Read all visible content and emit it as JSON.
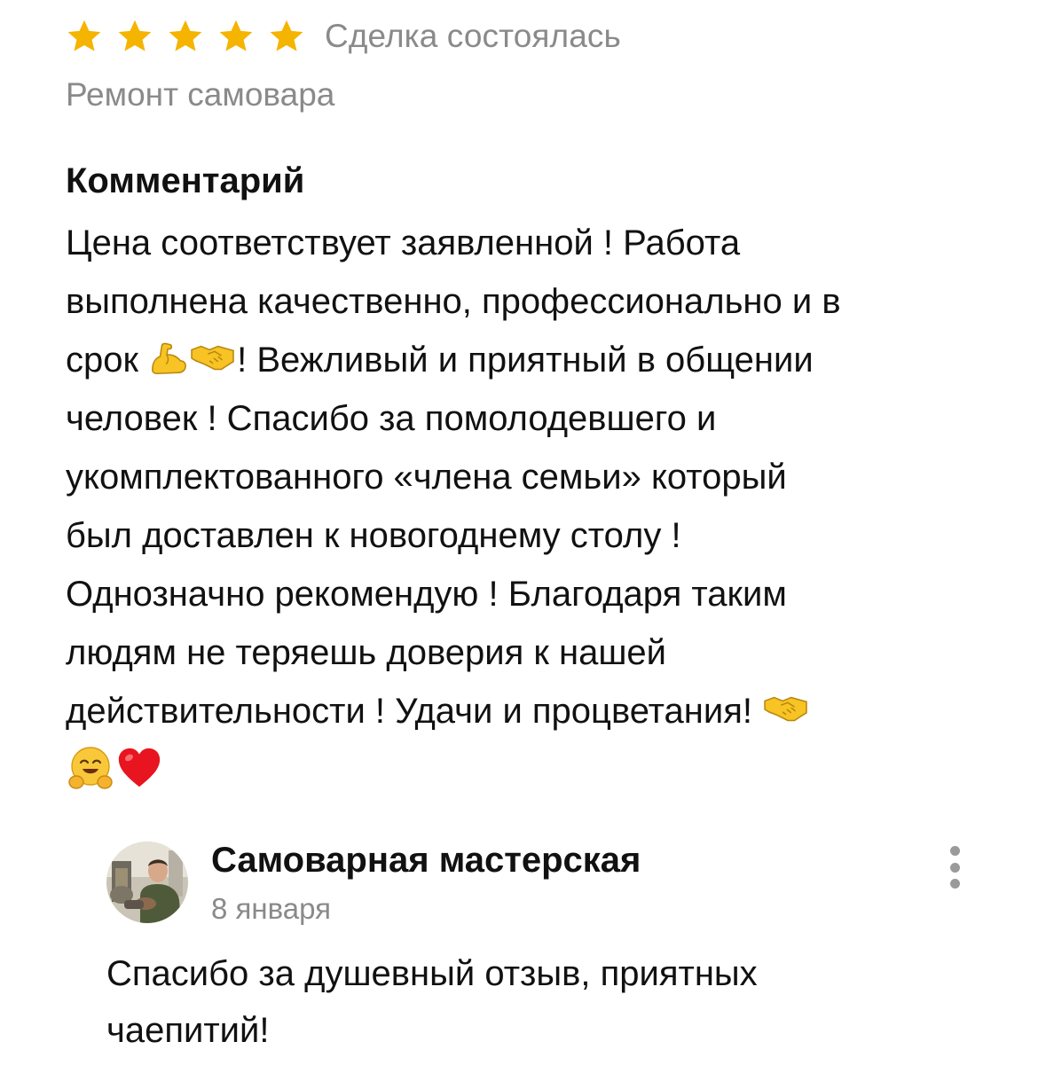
{
  "review": {
    "rating": 5,
    "rating_max": 5,
    "star_color": "#F5B400",
    "deal_status": "Сделка состоялась",
    "service_name": "Ремонт самовара",
    "comment_heading": "Комментарий",
    "comment_lines": [
      "Цена соответствует заявленной ! Работа",
      "выполнена качественно, профессионально и в",
      "срок ",
      "! Вежливый и приятный в общении",
      "человек ! Спасибо за  помолодевшего и",
      "укомплектованного «члена семьи» который",
      "был доставлен к новогоднему столу !",
      "Однозначно рекомендую ! Благодаря таким",
      "людям не теряешь доверия к нашей",
      "действительности ! Удачи и процветания! "
    ],
    "emoji": [
      "flexed-biceps",
      "handshake",
      "handshake",
      "hugging-face",
      "red-heart"
    ]
  },
  "reply": {
    "author": "Самоварная мастерская",
    "date": "8 января",
    "text_lines": [
      "Спасибо за душевный отзыв, приятных",
      "чаепитий!"
    ],
    "menu_icon": "more-vertical-icon"
  }
}
